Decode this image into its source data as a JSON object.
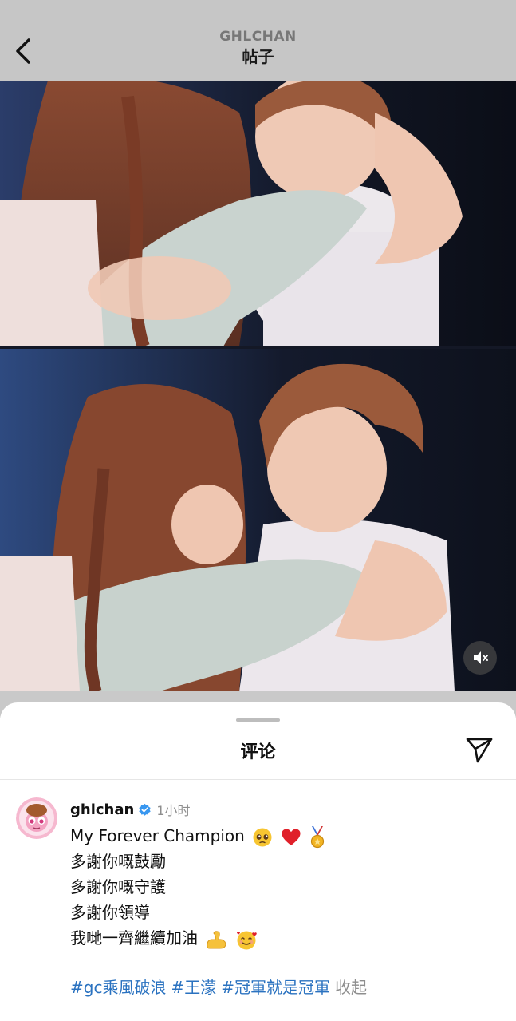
{
  "header": {
    "username": "GHLCHAN",
    "title": "帖子",
    "back_icon": "chevron-left-icon"
  },
  "video": {
    "muted": true,
    "mute_icon": "speaker-muted-icon"
  },
  "comments_sheet": {
    "title": "评论",
    "share_icon": "paper-plane-icon",
    "comment": {
      "username": "ghlchan",
      "verified": true,
      "time": "1小时",
      "lines": [
        "My Forever Champion",
        "多謝你嘅鼓勵",
        "多謝你嘅守護",
        "多謝你領導",
        "我哋一齊繼續加油"
      ],
      "line_emojis": [
        [
          "pleading-face-emoji",
          "red-heart-emoji",
          "medal-emoji"
        ],
        [],
        [],
        [],
        [
          "flexed-biceps-emoji",
          "smiling-face-hearts-emoji"
        ]
      ],
      "hashtags": [
        "#gc乘風破浪",
        "#王濛",
        "#冠軍就是冠軍"
      ],
      "collapse_label": "收起"
    }
  },
  "colors": {
    "hashtag": "#2a72c0",
    "secondary_text": "#8e8e8e",
    "verified": "#3897f0",
    "heart": "#e0202a"
  }
}
